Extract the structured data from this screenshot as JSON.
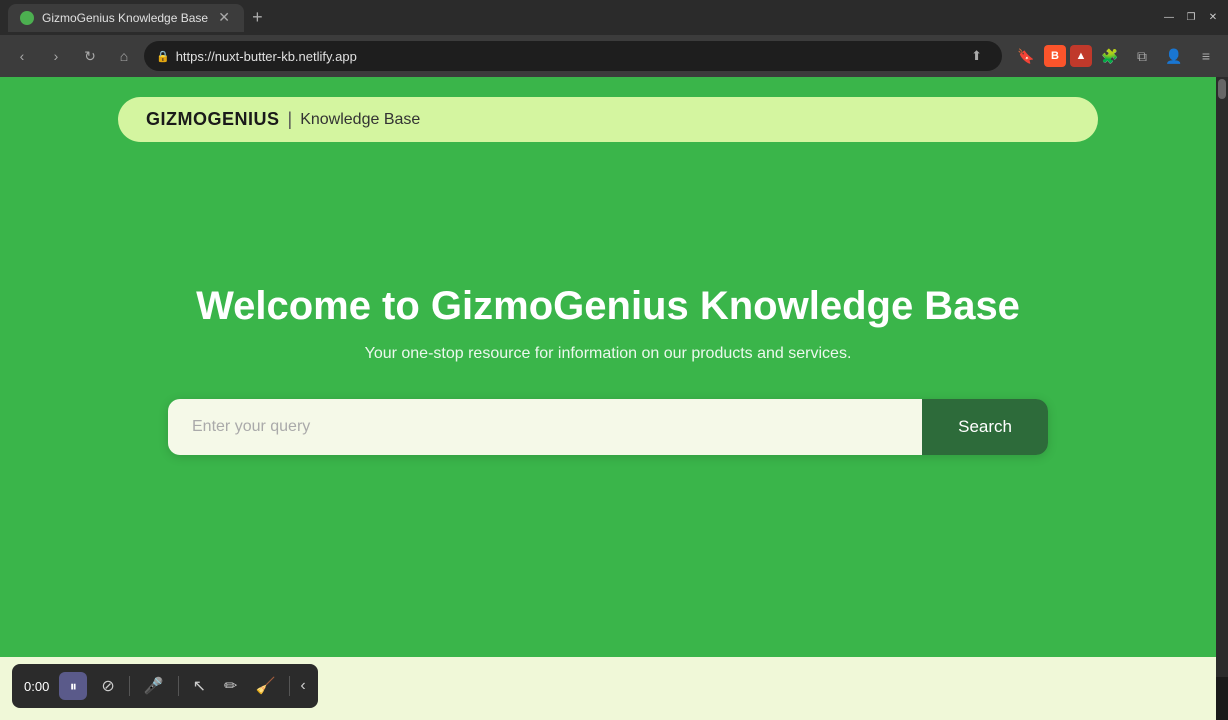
{
  "browser": {
    "tab": {
      "title": "GizmoGenius Knowledge Base",
      "favicon_color": "#4caf50"
    },
    "address": {
      "url": "https://nuxt-butter-kb.netlify.app",
      "new_tab_label": "+"
    },
    "window_controls": {
      "minimize": "—",
      "maximize": "❐",
      "close": "✕"
    }
  },
  "navbar": {
    "brand": "GIZMOGENIUS",
    "separator": "|",
    "section": "Knowledge Base"
  },
  "hero": {
    "title": "Welcome to GizmoGenius Knowledge Base",
    "subtitle": "Your one-stop resource for information on our products and services."
  },
  "search": {
    "placeholder": "Enter your query",
    "button_label": "Search"
  },
  "toolbar": {
    "time": "0:00",
    "tools": [
      "pause",
      "eraser",
      "mic",
      "cursor",
      "pen",
      "eraser2",
      "back"
    ]
  }
}
